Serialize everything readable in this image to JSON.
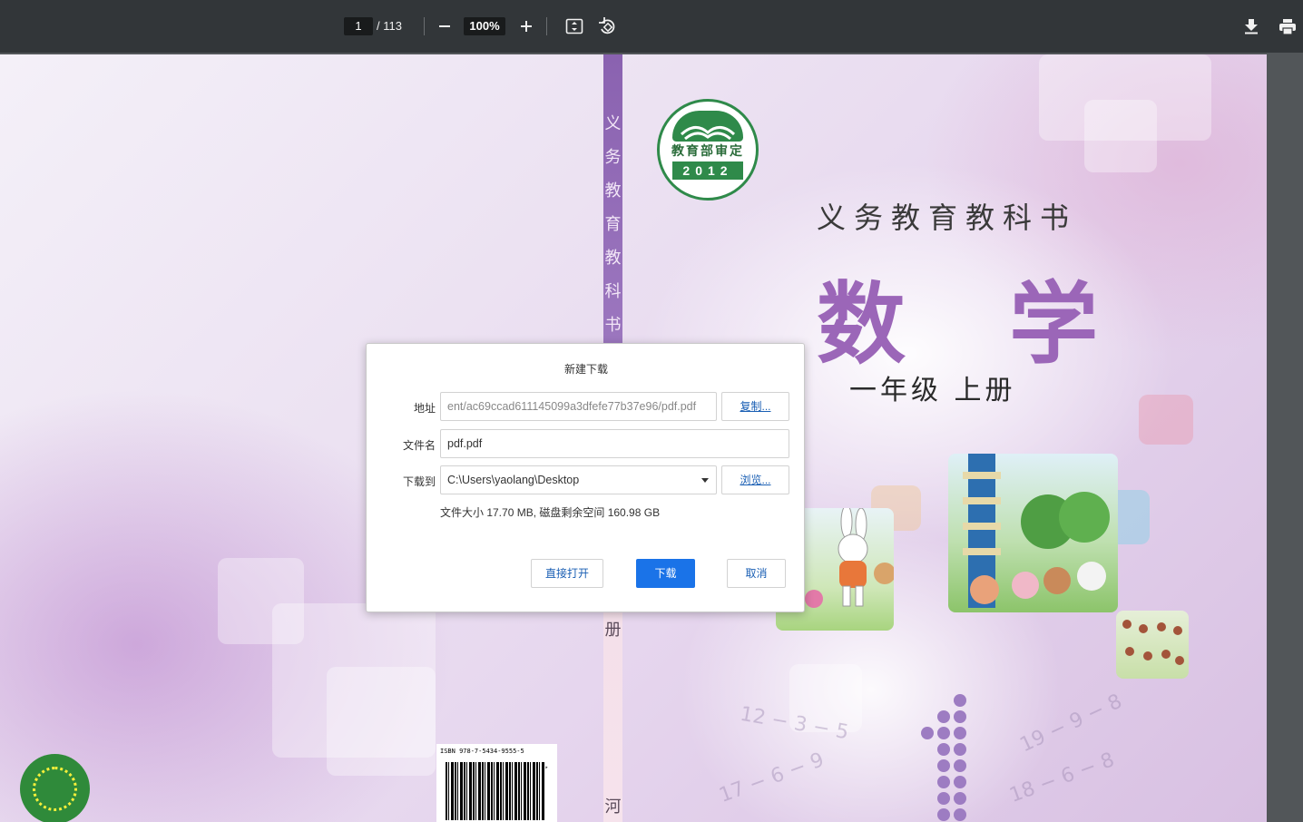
{
  "toolbar": {
    "page_current": "1",
    "page_total": "/ 113",
    "zoom": "100%",
    "icons": [
      "minus-icon",
      "plus-icon",
      "fit-page-icon",
      "rotate-icon",
      "download-icon",
      "print-icon"
    ]
  },
  "pdf": {
    "spine_text": [
      "义",
      "务",
      "教",
      "育",
      "教",
      "科",
      "书"
    ],
    "spine_bottom": "册",
    "spine_bottom2": "河",
    "badge_text": "教育部审定",
    "badge_year": "2012",
    "series": "义务教育教科书",
    "title": "数 学",
    "grade": "一年级  上册",
    "isbn": "ISBN 978-7-5434-9555-5",
    "barcode_suffix": "01>"
  },
  "dialog": {
    "title": "新建下载",
    "address_label": "地址",
    "address_value": "ent/ac69ccad611145099a3dfefe77b37e96/pdf.pdf",
    "copy_button": "复制...",
    "filename_label": "文件名",
    "filename_value": "pdf.pdf",
    "saveto_label": "下载到",
    "saveto_value": "C:\\Users\\yaolang\\Desktop",
    "browse_button": "浏览...",
    "info": "文件大小  17.70 MB, 磁盘剩余空间 160.98 GB",
    "open_button": "直接打开",
    "download_button": "下载",
    "cancel_button": "取消"
  },
  "colors": {
    "toolbar_bg": "#323639",
    "primary": "#1a73e8",
    "title_purple": "#9b66b8",
    "badge_green": "#2f8a4a"
  }
}
